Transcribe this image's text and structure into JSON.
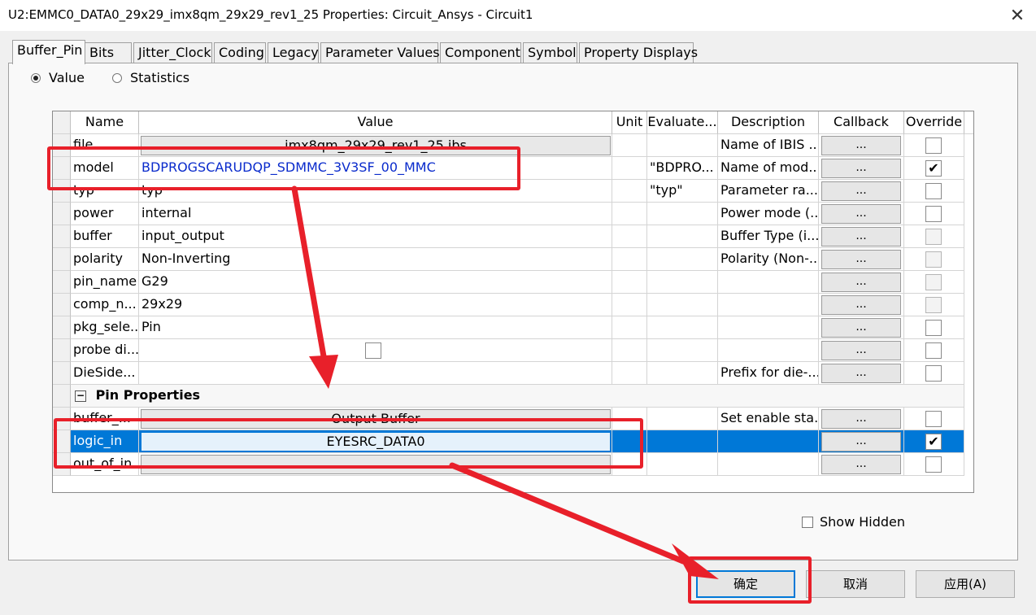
{
  "window": {
    "title": "U2:EMMC0_DATA0_29x29_imx8qm_29x29_rev1_25 Properties: Circuit_Ansys - Circuit1",
    "close_glyph": "✕"
  },
  "tabs": [
    "Buffer_Pin",
    "Bits",
    "Jitter_Clock",
    "Coding",
    "Legacy",
    "Parameter Values",
    "Component",
    "Symbol",
    "Property Displays"
  ],
  "view_mode": {
    "value_label": "Value",
    "statistics_label": "Statistics",
    "selected": "Value"
  },
  "grid": {
    "columns": [
      "Name",
      "Value",
      "Unit",
      "Evaluate...",
      "Description",
      "Callback",
      "Override"
    ],
    "callback_label": "...",
    "check_mark": "✔",
    "collapse_glyph": "−",
    "rows": [
      {
        "name": "file",
        "value": "imx8qm_29x29_rev1_25.ibs",
        "evaluated": "",
        "description": "Name of IBIS ..."
      },
      {
        "name": "model",
        "value": "BDPROGSCARUDQP_SDMMC_3V3SF_00_MMC",
        "evaluated": "\"BDPRO...",
        "description": "Name of mod..."
      },
      {
        "name": "typ",
        "value": "typ",
        "evaluated": "\"typ\"",
        "description": "Parameter ra..."
      },
      {
        "name": "power",
        "value": "internal",
        "evaluated": "",
        "description": "Power mode (..."
      },
      {
        "name": "buffer",
        "value": "input_output",
        "evaluated": "",
        "description": "Buffer Type (i..."
      },
      {
        "name": "polarity",
        "value": "Non-Inverting",
        "evaluated": "",
        "description": "Polarity (Non-..."
      },
      {
        "name": "pin_name",
        "value": "G29",
        "evaluated": "",
        "description": ""
      },
      {
        "name": "comp_n...",
        "value": "29x29",
        "evaluated": "",
        "description": ""
      },
      {
        "name": "pkg_sele...",
        "value": "Pin",
        "evaluated": "",
        "description": ""
      },
      {
        "name": "probe di...",
        "value": "",
        "evaluated": "",
        "description": ""
      },
      {
        "name": "DieSide...",
        "value": "",
        "evaluated": "",
        "description": "Prefix for die-..."
      }
    ],
    "section_title": "Pin Properties",
    "pin_rows": [
      {
        "name": "buffer_...",
        "value": "Output Buffer",
        "description": "Set enable sta..."
      },
      {
        "name": "logic_in",
        "value": "EYESRC_DATA0",
        "description": ""
      },
      {
        "name": "out_of_in",
        "value": "",
        "description": ""
      }
    ]
  },
  "show_hidden_label": "Show Hidden",
  "buttons": {
    "ok": "确定",
    "cancel": "取消",
    "apply": "应用(A)"
  },
  "annotation_color": "#e8202a"
}
